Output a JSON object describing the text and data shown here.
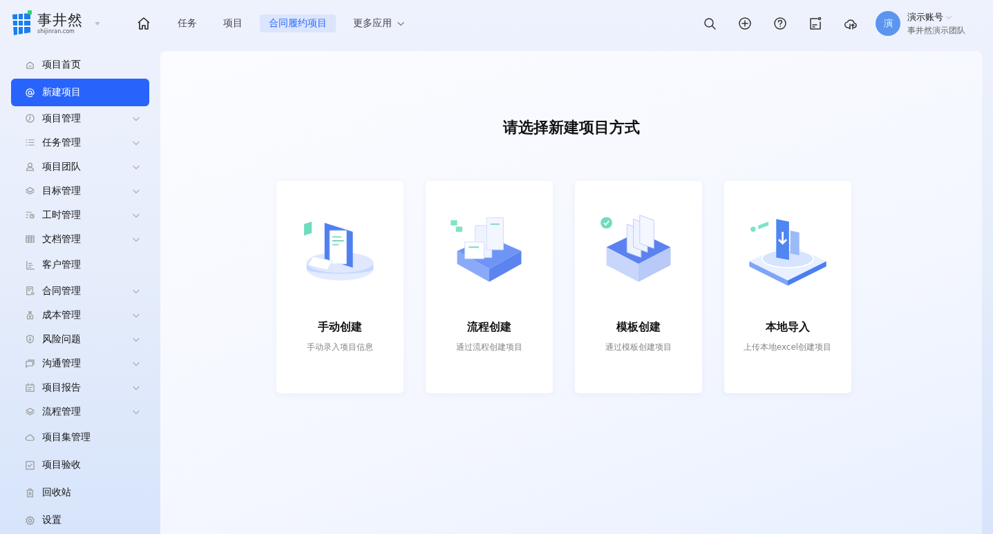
{
  "logo": {
    "name": "事井然",
    "domain": "shijinran.com"
  },
  "nav": [
    {
      "label": "任务",
      "selected": false
    },
    {
      "label": "项目",
      "selected": false
    },
    {
      "label": "合同履约项目",
      "selected": true
    },
    {
      "label": "更多应用",
      "selected": false,
      "dropdown": true
    }
  ],
  "user": {
    "avatar": "演",
    "name": "演示账号",
    "team": "事井然演示团队"
  },
  "sidebar": {
    "items": [
      {
        "label": "项目首页",
        "selected": false,
        "expandable": false
      },
      {
        "label": "新建项目",
        "selected": true,
        "expandable": false
      },
      {
        "label": "项目管理",
        "selected": false,
        "expandable": true
      },
      {
        "label": "任务管理",
        "selected": false,
        "expandable": true
      },
      {
        "label": "项目团队",
        "selected": false,
        "expandable": true
      },
      {
        "label": "目标管理",
        "selected": false,
        "expandable": true
      },
      {
        "label": "工时管理",
        "selected": false,
        "expandable": true
      },
      {
        "label": "文档管理",
        "selected": false,
        "expandable": true
      },
      {
        "label": "客户管理",
        "selected": false,
        "expandable": false
      },
      {
        "label": "合同管理",
        "selected": false,
        "expandable": true
      },
      {
        "label": "成本管理",
        "selected": false,
        "expandable": true
      },
      {
        "label": "风险问题",
        "selected": false,
        "expandable": true
      },
      {
        "label": "沟通管理",
        "selected": false,
        "expandable": true
      },
      {
        "label": "项目报告",
        "selected": false,
        "expandable": true
      },
      {
        "label": "流程管理",
        "selected": false,
        "expandable": true
      },
      {
        "label": "项目集管理",
        "selected": false,
        "expandable": false
      },
      {
        "label": "项目验收",
        "selected": false,
        "expandable": false
      },
      {
        "label": "回收站",
        "selected": false,
        "expandable": false
      },
      {
        "label": "设置",
        "selected": false,
        "expandable": false
      }
    ]
  },
  "main": {
    "title": "请选择新建项目方式",
    "options": [
      {
        "title": "手动创建",
        "description": "手动录入项目信息"
      },
      {
        "title": "流程创建",
        "description": "通过流程创建项目"
      },
      {
        "title": "模板创建",
        "description": "通过模板创建项目"
      },
      {
        "title": "本地导入",
        "description": "上传本地excel创建项目"
      }
    ]
  }
}
